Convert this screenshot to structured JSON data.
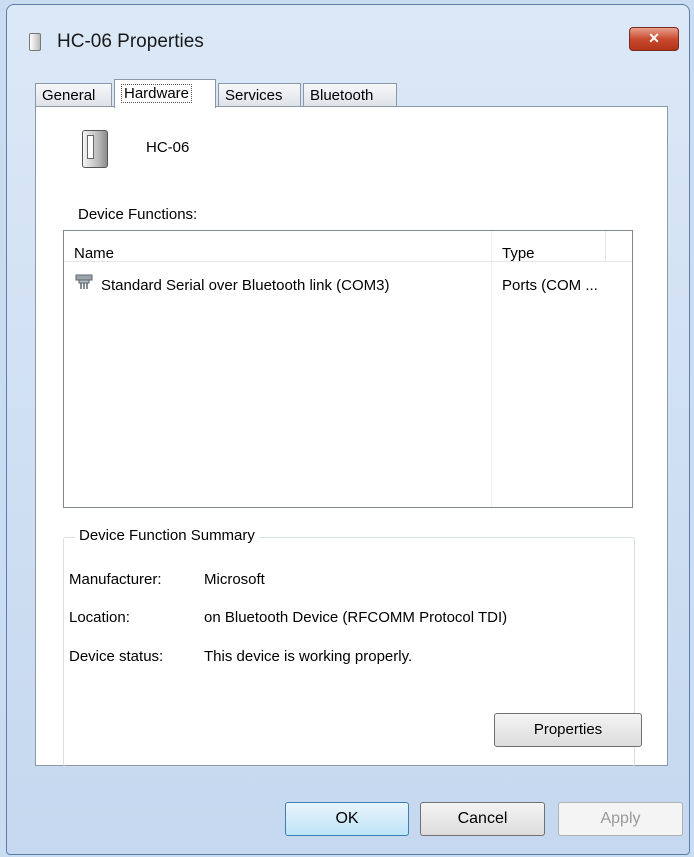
{
  "window": {
    "title": "HC-06 Properties",
    "close_label": "✕"
  },
  "tabs": [
    {
      "label": "General"
    },
    {
      "label": "Hardware",
      "active": true
    },
    {
      "label": "Services"
    },
    {
      "label": "Bluetooth"
    }
  ],
  "device": {
    "name": "HC-06",
    "icon": "device-tower-icon"
  },
  "functions": {
    "label": "Device Functions:",
    "columns": [
      "Name",
      "Type"
    ],
    "rows": [
      {
        "name": "Standard Serial over Bluetooth link (COM3)",
        "type": "Ports (COM ...",
        "icon": "port-connector-icon"
      }
    ]
  },
  "summary": {
    "title": "Device Function Summary",
    "manufacturer_label": "Manufacturer:",
    "manufacturer": "Microsoft",
    "location_label": "Location:",
    "location": "on Bluetooth Device (RFCOMM Protocol TDI)",
    "status_label": "Device status:",
    "status": "This device is working properly.",
    "properties_button": "Properties"
  },
  "buttons": {
    "ok": "OK",
    "cancel": "Cancel",
    "apply": "Apply"
  }
}
